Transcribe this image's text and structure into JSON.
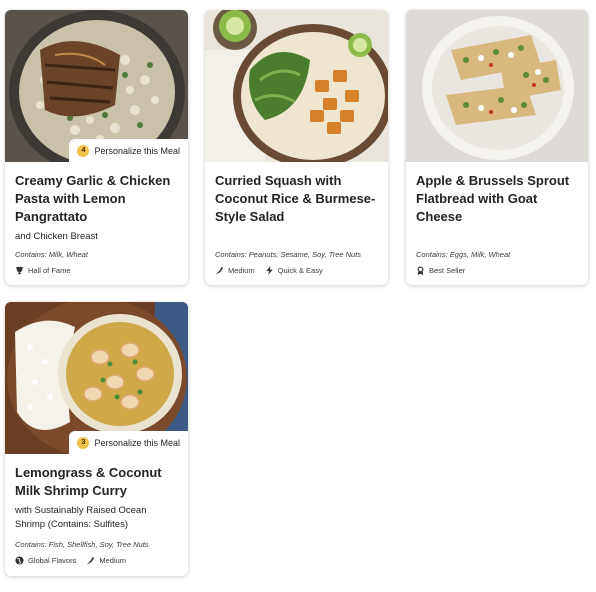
{
  "cards": [
    {
      "title": "Creamy Garlic & Chicken Pasta with Lemon Pangrattato",
      "subtitle": "and Chicken Breast",
      "contains": "Contains: Milk, Wheat",
      "personalize": {
        "count": "4",
        "label": "Personalize this Meal"
      },
      "tags": [
        {
          "icon": "trophy-icon",
          "label": "Hall of Fame"
        }
      ]
    },
    {
      "title": "Curried Squash with Coconut Rice & Burmese-Style Salad",
      "subtitle": "",
      "contains": "Contains: Peanuts, Sesame, Soy, Tree Nuts",
      "tags": [
        {
          "icon": "chili-pepper-icon",
          "label": "Medium"
        },
        {
          "icon": "lightning-bolt-icon",
          "label": "Quick & Easy"
        }
      ]
    },
    {
      "title": "Apple & Brussels Sprout Flatbread with Goat Cheese",
      "subtitle": "",
      "contains": "Contains: Eggs, Milk, Wheat",
      "tags": [
        {
          "icon": "best-seller-icon",
          "label": "Best Seller"
        }
      ]
    },
    {
      "title": "Lemongrass & Coconut Milk Shrimp Curry",
      "subtitle": "with Sustainably Raised Ocean Shrimp (Contains: Sulfites)",
      "contains": "Contains: Fish, Shellfish, Soy, Tree Nuts",
      "personalize": {
        "count": "3",
        "label": "Personalize this Meal"
      },
      "tags": [
        {
          "icon": "globe-icon",
          "label": "Global Flavors"
        },
        {
          "icon": "chili-pepper-icon",
          "label": "Medium"
        }
      ]
    }
  ]
}
